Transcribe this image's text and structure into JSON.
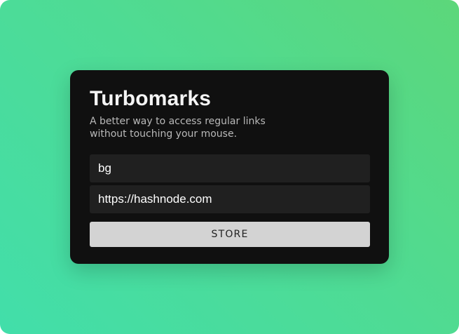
{
  "app": {
    "title": "Turbomarks",
    "subtitle": "A better way to access regular links without touching your mouse."
  },
  "form": {
    "keyword_value": "bg",
    "url_value": "https://hashnode.com",
    "store_label": "STORE"
  },
  "colors": {
    "card_background": "#101010",
    "field_background": "#202020",
    "button_background": "#d3d3d3",
    "gradient_start": "#5cd77a",
    "gradient_end": "#42deaa"
  }
}
